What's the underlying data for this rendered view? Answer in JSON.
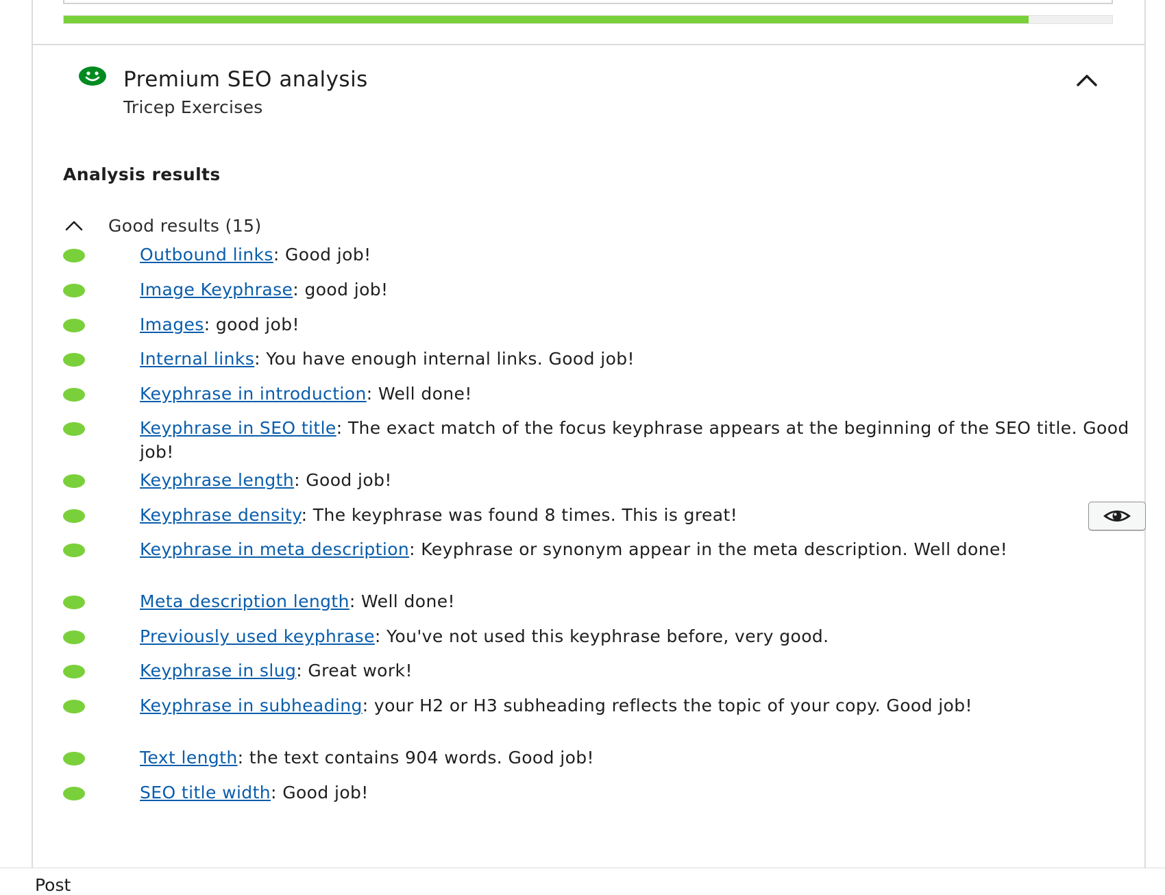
{
  "progress": {
    "value_percent": 92,
    "fill_color": "#7ad03a"
  },
  "header": {
    "icon": "smiley-face-icon",
    "icon_color": "#008a20",
    "title": "Premium SEO analysis",
    "subtitle": "Tricep Exercises",
    "toggle_icon": "chevron-up-icon"
  },
  "analysis": {
    "heading": "Analysis results",
    "good_toggle_label": "Good results (15)",
    "bullet_color": "#7ad03a",
    "link_color": "#0a5dab",
    "items": [
      {
        "link": "Outbound links",
        "text": ": Good job!"
      },
      {
        "link": "Image Keyphrase",
        "text": ": good job!"
      },
      {
        "link": "Images",
        "text": ": good job!"
      },
      {
        "link": "Internal links",
        "text": ": You have enough internal links. Good job!"
      },
      {
        "link": "Keyphrase in introduction",
        "text": ": Well done!"
      },
      {
        "link": "Keyphrase in SEO title",
        "text": ": The exact match of the focus keyphrase appears at the beginning of the SEO title. Good job!"
      },
      {
        "link": "Keyphrase length",
        "text": ": Good job!"
      },
      {
        "link": "Keyphrase density",
        "text": ": The keyphrase was found 8 times. This is great!",
        "action_icon": "eye-icon"
      },
      {
        "link": "Keyphrase in meta description",
        "text": ": Keyphrase or synonym appear in the meta description. Well done!"
      },
      {
        "link": "Meta description length",
        "text": ": Well done!"
      },
      {
        "link": "Previously used keyphrase",
        "text": ": You've not used this keyphrase before, very good."
      },
      {
        "link": "Keyphrase in slug",
        "text": ": Great work!"
      },
      {
        "link": "Keyphrase in subheading",
        "text": ": your H2 or H3 subheading reflects the topic of your copy. Good job!"
      },
      {
        "link": "Text length",
        "text": ": the text contains 904 words. Good job!"
      },
      {
        "link": "SEO title width",
        "text": ": Good job!"
      }
    ]
  },
  "footer": {
    "label": "Post"
  }
}
